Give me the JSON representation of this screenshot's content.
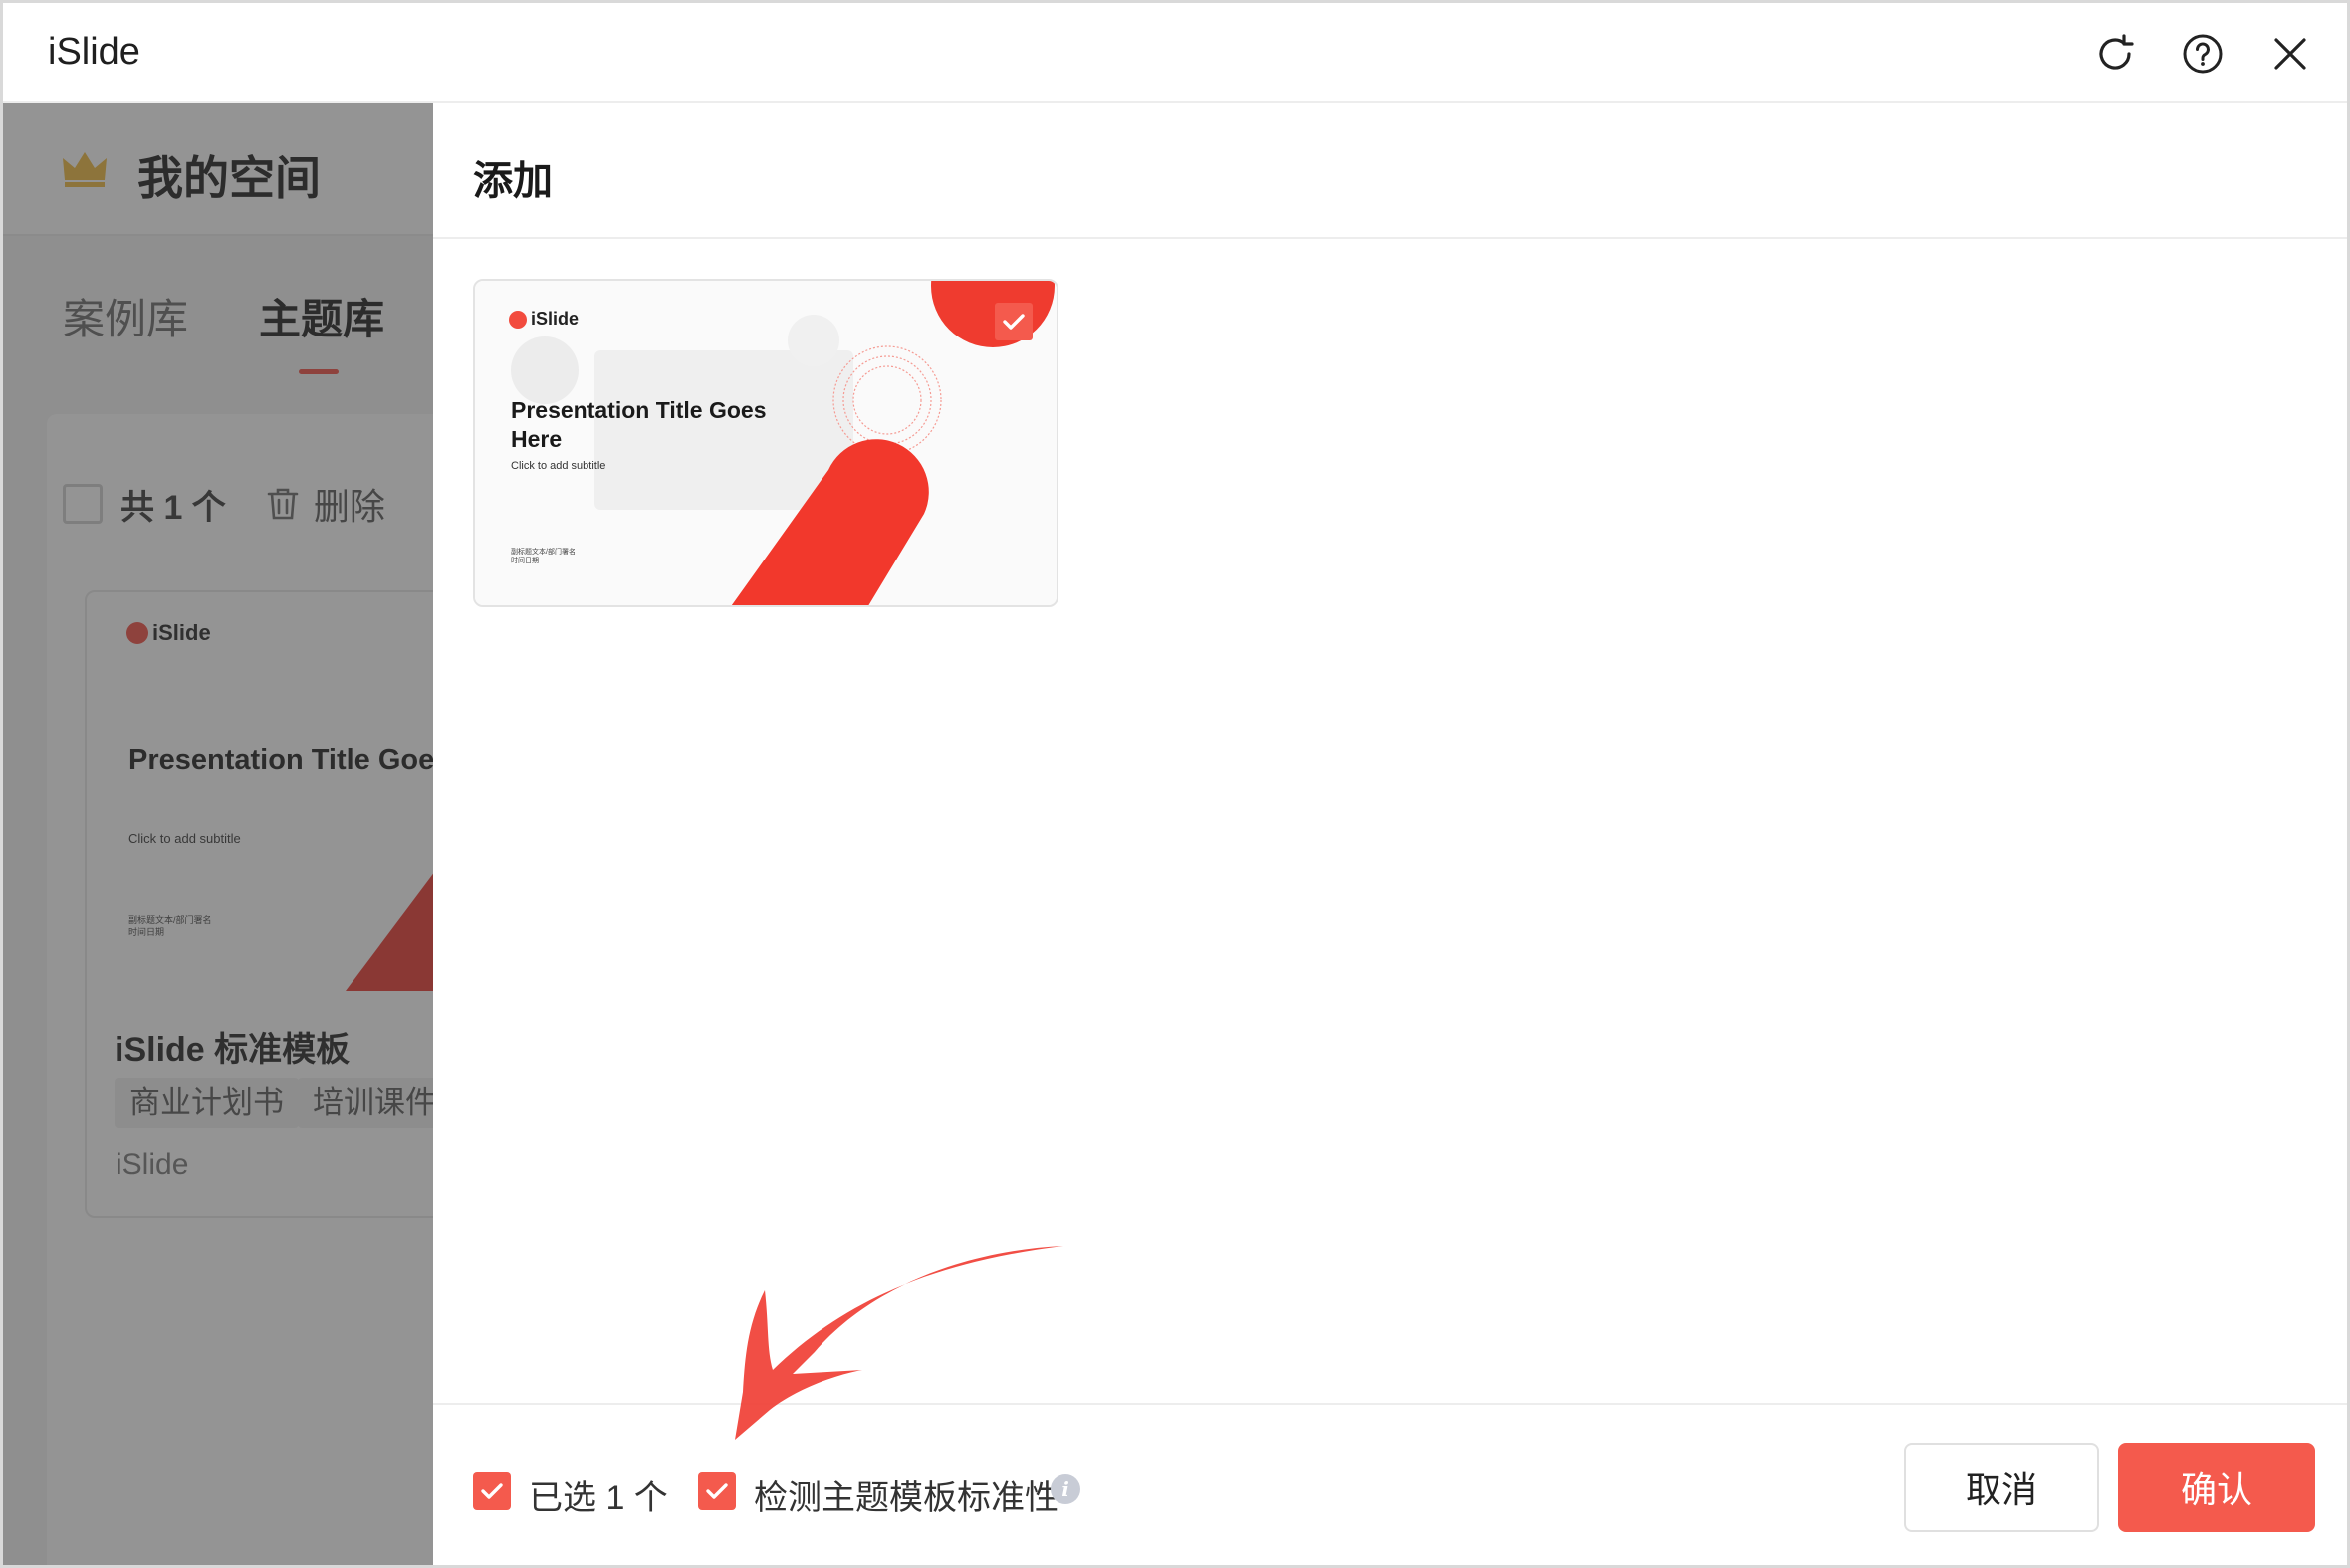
{
  "app": {
    "title": "iSlide"
  },
  "titlebar": {
    "refresh_icon": "refresh-icon",
    "help_icon": "help-icon",
    "close_icon": "close-icon"
  },
  "sidebar": {
    "space_title": "我的空间",
    "crown_icon": "crown-icon",
    "tabs": [
      {
        "label": "案例库",
        "active": false
      },
      {
        "label": "主题库",
        "active": true
      }
    ],
    "toolbar": {
      "count_label": "共 1 个",
      "delete_label": "删除"
    },
    "template": {
      "name": "iSlide 标准模板",
      "tags": [
        "商业计划书",
        "培训课件"
      ],
      "author": "iSlide"
    }
  },
  "main": {
    "title": "添加",
    "thumbnail": {
      "logo": "iSlide",
      "slide_title": "Presentation Title Goes Here",
      "slide_subtitle": "Click to add subtitle",
      "small_line1": "副标题文本/部门署名",
      "small_line2": "时间日期",
      "selected": true
    }
  },
  "footer": {
    "selected_label": "已选 1 个",
    "check_label": "检测主题模板标准性",
    "cancel_label": "取消",
    "confirm_label": "确认"
  },
  "colors": {
    "accent": "#f45a4d",
    "dim_overlay": "#3c3c3c"
  }
}
